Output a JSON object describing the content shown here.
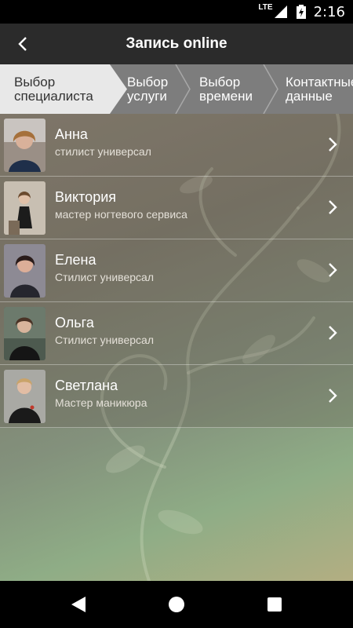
{
  "status_bar": {
    "network": "LTE",
    "time": "2:16"
  },
  "app_bar": {
    "title": "Запись online"
  },
  "steps": [
    {
      "line1": "Выбор",
      "line2": "специалиста",
      "active": true
    },
    {
      "line1": "Выбор",
      "line2": "услуги",
      "active": false
    },
    {
      "line1": "Выбор",
      "line2": "времени",
      "active": false
    },
    {
      "line1": "Контактные",
      "line2": "данные",
      "active": false
    }
  ],
  "specialists": [
    {
      "name": "Анна",
      "role": "стилист универсал"
    },
    {
      "name": "Виктория",
      "role": "мастер ногтевого сервиса"
    },
    {
      "name": "Елена",
      "role": "Стилист универсал"
    },
    {
      "name": "Ольга",
      "role": "Стилист универсал"
    },
    {
      "name": "Светлана",
      "role": "Мастер маникюра"
    }
  ],
  "icons": {
    "back": "arrow-back-icon",
    "chevron": "chevron-right-icon",
    "nav_back": "triangle-back-icon",
    "nav_home": "circle-home-icon",
    "nav_recents": "square-recents-icon"
  },
  "colors": {
    "app_bar": "#2b2b2b",
    "active_step": "#e8e8e8",
    "inactive_steps": "#7d7d7d"
  }
}
